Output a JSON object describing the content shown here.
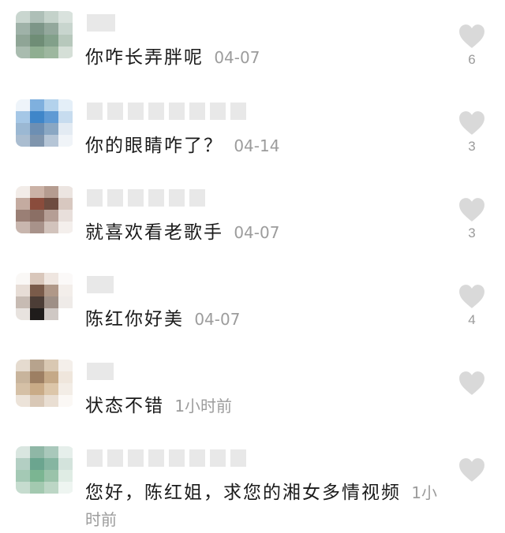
{
  "comments": [
    {
      "text": "你咋长弄胖呢",
      "time": "04-07",
      "likes": "6"
    },
    {
      "text": "你的眼睛咋了？",
      "time": "04-14",
      "likes": "3"
    },
    {
      "text": "就喜欢看老歌手",
      "time": "04-07",
      "likes": "3"
    },
    {
      "text": "陈红你好美",
      "time": "04-07",
      "likes": "4"
    },
    {
      "text": "状态不错",
      "time": "1小时前",
      "likes": ""
    },
    {
      "text": "您好，陈红姐，求您的湘女多情视频",
      "time": "1小时前",
      "likes": ""
    }
  ],
  "colors": {
    "heart": "#d9d9d9",
    "time": "#9c9c9c",
    "text": "#1b1b1b"
  },
  "icons": {
    "like": "heart-icon"
  }
}
